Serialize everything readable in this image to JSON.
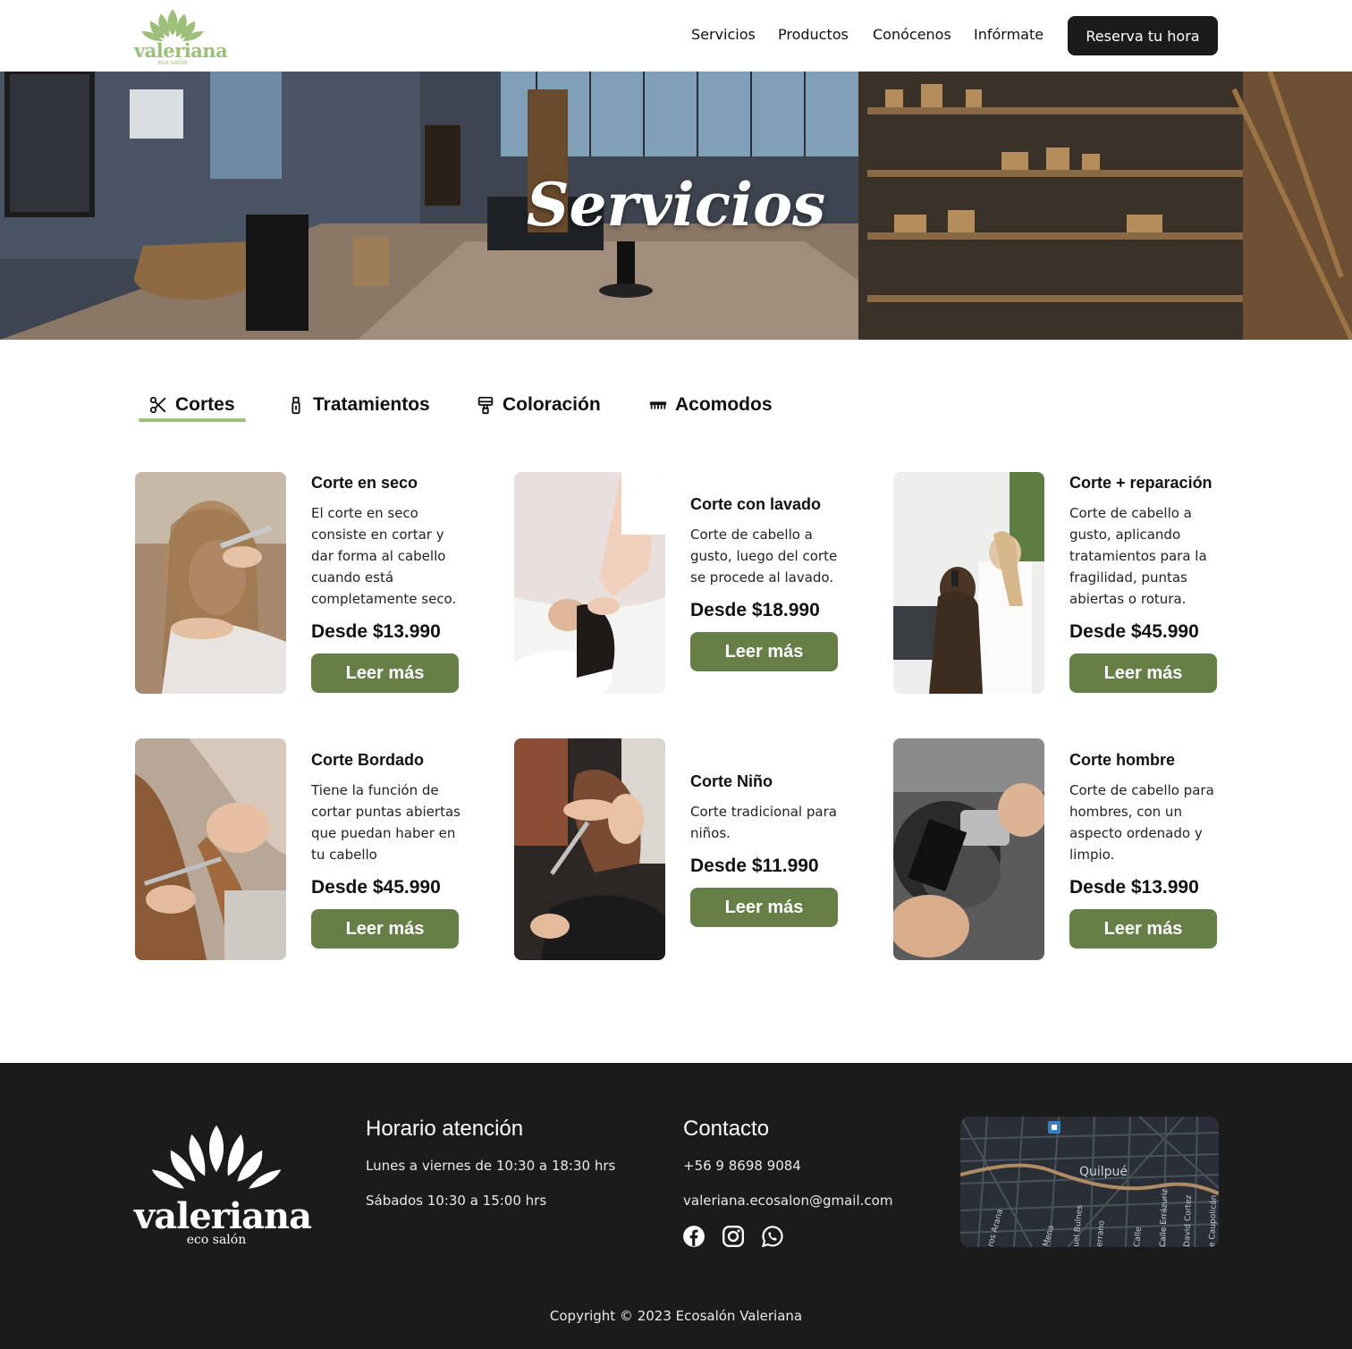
{
  "brand": {
    "name": "valeriana",
    "subtitle": "eco salón",
    "accent": "#9cc07a",
    "button_green": "#667f47",
    "dark": "#1b1b1b"
  },
  "nav": {
    "items": [
      "Servicios",
      "Productos",
      "Conócenos",
      "Infórmate"
    ],
    "cta": "Reserva tu hora"
  },
  "hero": {
    "title": "Servicios"
  },
  "tabs": [
    {
      "label": "Cortes",
      "icon": "scissors-icon",
      "active": true
    },
    {
      "label": "Tratamientos",
      "icon": "spray-bottle-icon",
      "active": false
    },
    {
      "label": "Coloración",
      "icon": "paint-roller-icon",
      "active": false
    },
    {
      "label": "Acomodos",
      "icon": "comb-icon",
      "active": false
    }
  ],
  "services": [
    {
      "title": "Corte en seco",
      "description": "El corte en seco consiste en cortar y dar forma al cabello cuando está completamente seco.",
      "price": "Desde $13.990",
      "button": "Leer más"
    },
    {
      "title": "Corte con lavado",
      "description": "Corte de cabello a gusto, luego del corte se  procede al lavado.",
      "price": "Desde $18.990",
      "button": "Leer más"
    },
    {
      "title": "Corte + reparación",
      "description": "Corte de cabello a gusto, aplicando tratamientos para la fragilidad, puntas abiertas o rotura.",
      "price": "Desde $45.990",
      "button": "Leer más"
    },
    {
      "title": "Corte Bordado",
      "description": " Tiene la función de cortar puntas abiertas  que puedan haber en tu  cabello",
      "price": "Desde $45.990",
      "button": "Leer más"
    },
    {
      "title": "Corte Niño",
      "description": "Corte tradicional para niños.",
      "price": "Desde $11.990",
      "button": "Leer más"
    },
    {
      "title": "Corte hombre",
      "description": "Corte de cabello para hombres, con un aspecto ordenado y limpio.",
      "price": "Desde $13.990",
      "button": "Leer más"
    }
  ],
  "footer": {
    "hours_title": "Horario atención",
    "hours": [
      "Lunes a viernes de 10:30 a 18:30 hrs",
      "Sábados 10:30 a 15:00 hrs"
    ],
    "contact_title": "Contacto",
    "phone": "+56 9 8698 9084",
    "email": "valeriana.ecosalon@gmail.com",
    "social": [
      "facebook-icon",
      "instagram-icon",
      "whatsapp-icon"
    ],
    "map": {
      "city": "Quilpué",
      "streets": [
        "ros Arana",
        "Mena",
        "uel Bulnes",
        "errano",
        "Calle",
        "Calle Errázuriz",
        "David Cortez",
        "e Caupolicán"
      ]
    },
    "copyright": "Copyright © 2023 Ecosalón Valeriana"
  }
}
